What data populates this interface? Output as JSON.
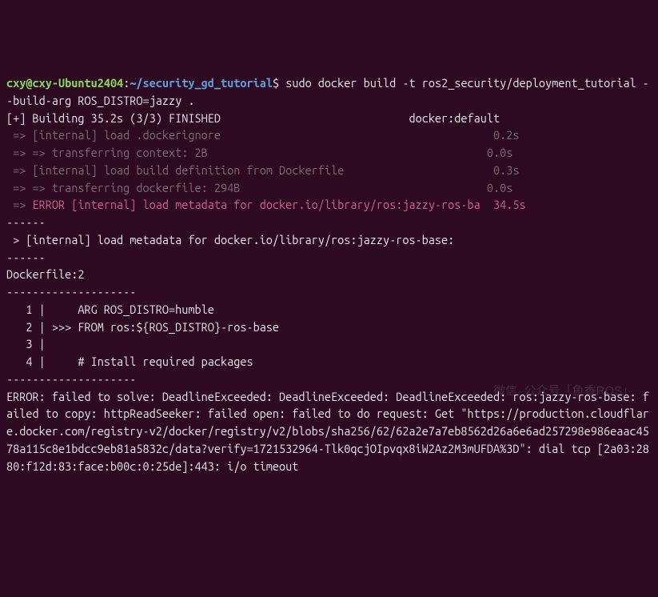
{
  "prompt": {
    "user": "cxy",
    "at": "@",
    "host": "cxy-Ubuntu2404",
    "colon": ":",
    "path": "~/security_gd_tutorial",
    "sym": "$",
    "cmd": "sudo docker build -t ros2_security/deployment_tutorial --build-arg ROS_DISTRO=jazzy ."
  },
  "build_status": {
    "left": "[+] Building 35.2s (3/3) FINISHED",
    "right": "docker:default"
  },
  "steps": [
    {
      "arrow": " => ",
      "text": "[internal] load .dockerignore",
      "time": "0.2s"
    },
    {
      "arrow": " => => ",
      "text": "transferring context: 2B",
      "time": "0.0s"
    },
    {
      "arrow": " => ",
      "text": "[internal] load build definition from Dockerfile",
      "time": "0.3s"
    },
    {
      "arrow": " => => ",
      "text": "transferring dockerfile: 294B",
      "time": "0.0s"
    }
  ],
  "error_step": {
    "arrow": " => ",
    "text": "ERROR [internal] load metadata for docker.io/library/ros:jazzy-ros-ba",
    "time": "34.5s"
  },
  "dashes1": "------",
  "internal_line": " > [internal] load metadata for docker.io/library/ros:jazzy-ros-base:",
  "dashes2": "------",
  "dockerfile_label": "Dockerfile:2",
  "df_dash_top": "--------------------",
  "df": {
    "l1": "   1 |     ARG ROS_DISTRO=humble",
    "l2": "   2 | >>> FROM ros:${ROS_DISTRO}-ros-base",
    "l3": "   3 |     ",
    "l4": "   4 |     # Install required packages"
  },
  "df_dash_bot": "--------------------",
  "error_msg": "ERROR: failed to solve: DeadlineExceeded: DeadlineExceeded: DeadlineExceeded: ros:jazzy-ros-base: failed to copy: httpReadSeeker: failed open: failed to do request: Get \"https://production.cloudflare.docker.com/registry-v2/docker/registry/v2/blobs/sha256/62/62a2e7a7eb8562d26a6e6ad257298e986eaac4578a115c8e1bdcc9eb81a5832c/data?verify=1721532964-Tlk0qcjOIpvqx8iW2Az2M3mUFDA%3D\": dial tcp [2a03:2880:f12d:83:face:b00c:0:25de]:443: i/o timeout",
  "watermark": "微信  公众号「鱼香ROS」"
}
